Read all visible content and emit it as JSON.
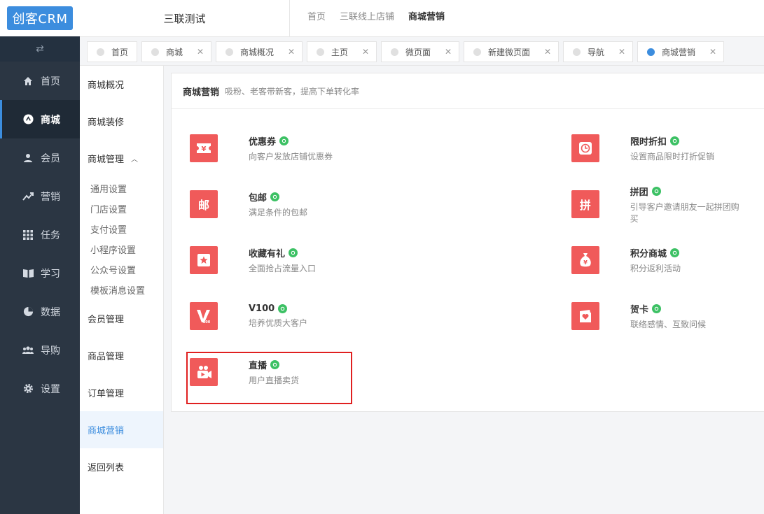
{
  "app": {
    "logo_text": "创客CRM",
    "collapse_icon": "swap-arrows-icon"
  },
  "sidebar": {
    "items": [
      {
        "label": "首页",
        "icon": "home-icon",
        "active": false
      },
      {
        "label": "商城",
        "icon": "mall-icon",
        "active": true
      },
      {
        "label": "会员",
        "icon": "user-icon",
        "active": false
      },
      {
        "label": "营销",
        "icon": "trend-icon",
        "active": false
      },
      {
        "label": "任务",
        "icon": "grid-icon",
        "active": false
      },
      {
        "label": "学习",
        "icon": "book-icon",
        "active": false
      },
      {
        "label": "数据",
        "icon": "pie-icon",
        "active": false
      },
      {
        "label": "导购",
        "icon": "group-icon",
        "active": false
      },
      {
        "label": "设置",
        "icon": "gear-icon",
        "active": false
      }
    ]
  },
  "header": {
    "shop_name": "三联测试",
    "breadcrumbs": [
      "首页",
      "三联线上店铺",
      "商城营销"
    ]
  },
  "tabs": [
    {
      "label": "首页",
      "closable": false,
      "active": false
    },
    {
      "label": "商城",
      "closable": true,
      "active": false
    },
    {
      "label": "商城概况",
      "closable": true,
      "active": false
    },
    {
      "label": "主页",
      "closable": true,
      "active": false
    },
    {
      "label": "微页面",
      "closable": true,
      "active": false
    },
    {
      "label": "新建微页面",
      "closable": true,
      "active": false
    },
    {
      "label": "导航",
      "closable": true,
      "active": false
    },
    {
      "label": "商城营销",
      "closable": true,
      "active": true
    }
  ],
  "submenu": {
    "overview": "商城概况",
    "decoration": "商城装修",
    "management": "商城管理",
    "children": [
      "通用设置",
      "门店设置",
      "支付设置",
      "小程序设置",
      "公众号设置",
      "模板消息设置"
    ],
    "member_mgmt": "会员管理",
    "product_mgmt": "商品管理",
    "order_mgmt": "订单管理",
    "marketing": "商城营销",
    "back": "返回列表"
  },
  "main": {
    "title": "商城营销",
    "subtitle": "吸粉、老客带新客，提高下单转化率",
    "features": [
      {
        "name": "优惠券",
        "desc": "向客户发放店铺优惠券",
        "icon": "coupon-icon",
        "glyph": "¥"
      },
      {
        "name": "限时折扣",
        "desc": "设置商品限时打折促销",
        "icon": "clock-icon",
        "glyph": "◷"
      },
      {
        "name": "包邮",
        "desc": "满足条件的包邮",
        "icon": "mail-icon",
        "glyph": "邮"
      },
      {
        "name": "拼团",
        "desc": "引导客户邀请朋友一起拼团购买",
        "icon": "group-buy-icon",
        "glyph": "拼"
      },
      {
        "name": "收藏有礼",
        "desc": "全面抢占流量入口",
        "icon": "star-icon",
        "glyph": "★"
      },
      {
        "name": "积分商城",
        "desc": "积分返利活动",
        "icon": "money-bag-icon",
        "glyph": "¥"
      },
      {
        "name": "V100",
        "desc": "培养优质大客户",
        "icon": "v100-icon",
        "glyph": "V"
      },
      {
        "name": "贺卡",
        "desc": "联络感情、互致问候",
        "icon": "card-icon",
        "glyph": "♥"
      },
      {
        "name": "直播",
        "desc": "用户直播卖货",
        "icon": "live-camera-icon",
        "glyph": "▶"
      }
    ]
  },
  "colors": {
    "accent": "#3c8dde",
    "feature_icon": "#f05a5a",
    "badge": "#3cc164",
    "sidebar_bg": "#2b3643",
    "highlight": "#e02020"
  }
}
